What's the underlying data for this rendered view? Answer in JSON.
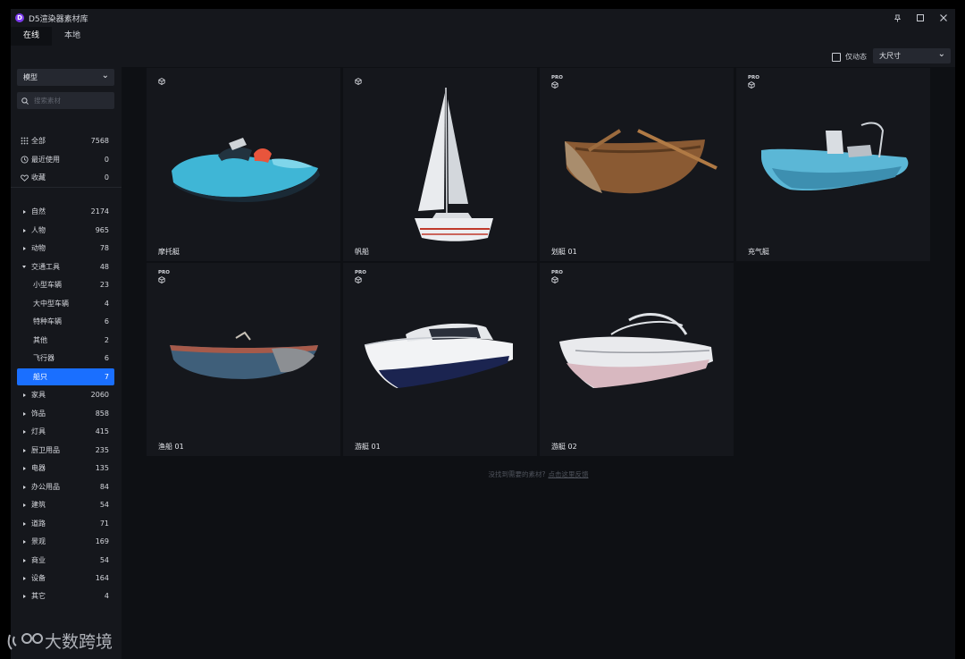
{
  "app": {
    "title": "D5渲染器素材库",
    "logo_letter": "D"
  },
  "window_controls": [
    "pin-icon",
    "maximize-icon",
    "close-icon"
  ],
  "tabs": [
    {
      "label": "在线",
      "active": true
    },
    {
      "label": "本地",
      "active": false
    }
  ],
  "toolbar": {
    "animated_only_label": "仅动态",
    "animated_only_checked": false,
    "size_value": "大尺寸"
  },
  "sidebar": {
    "type_value": "模型",
    "search_placeholder": "搜索素材",
    "quick": [
      {
        "label": "全部",
        "count": "7568",
        "icon": "grid-icon"
      },
      {
        "label": "最近使用",
        "count": "0",
        "icon": "clock-icon"
      },
      {
        "label": "收藏",
        "count": "0",
        "icon": "heart-icon"
      }
    ],
    "categories": [
      {
        "label": "自然",
        "count": "2174",
        "expanded": false
      },
      {
        "label": "人物",
        "count": "965",
        "expanded": false
      },
      {
        "label": "动物",
        "count": "78",
        "expanded": false
      },
      {
        "label": "交通工具",
        "count": "48",
        "expanded": true
      },
      {
        "label": "小型车辆",
        "count": "23",
        "child": true
      },
      {
        "label": "大中型车辆",
        "count": "4",
        "child": true
      },
      {
        "label": "特种车辆",
        "count": "6",
        "child": true
      },
      {
        "label": "其他",
        "count": "2",
        "child": true
      },
      {
        "label": "飞行器",
        "count": "6",
        "child": true
      },
      {
        "label": "船只",
        "count": "7",
        "child": true,
        "selected": true
      },
      {
        "label": "家具",
        "count": "2060",
        "expanded": false
      },
      {
        "label": "饰品",
        "count": "858",
        "expanded": false
      },
      {
        "label": "灯具",
        "count": "415",
        "expanded": false
      },
      {
        "label": "厨卫用品",
        "count": "235",
        "expanded": false
      },
      {
        "label": "电器",
        "count": "135",
        "expanded": false
      },
      {
        "label": "办公用品",
        "count": "84",
        "expanded": false
      },
      {
        "label": "建筑",
        "count": "54",
        "expanded": false
      },
      {
        "label": "道路",
        "count": "71",
        "expanded": false
      },
      {
        "label": "景观",
        "count": "169",
        "expanded": false
      },
      {
        "label": "商业",
        "count": "54",
        "expanded": false
      },
      {
        "label": "设备",
        "count": "164",
        "expanded": false
      },
      {
        "label": "其它",
        "count": "4",
        "expanded": false
      }
    ]
  },
  "items": [
    {
      "name": "摩托艇",
      "pro": false,
      "thumb": "jetski"
    },
    {
      "name": "帆船",
      "pro": false,
      "thumb": "sailboat"
    },
    {
      "name": "划艇 01",
      "pro": true,
      "thumb": "rowboat"
    },
    {
      "name": "充气艇",
      "pro": true,
      "thumb": "inflatable"
    },
    {
      "name": "渔船 01",
      "pro": true,
      "thumb": "fishing"
    },
    {
      "name": "游艇 01",
      "pro": true,
      "thumb": "yacht1"
    },
    {
      "name": "游艇 02",
      "pro": true,
      "thumb": "yacht2"
    }
  ],
  "pro_badge": "PRO",
  "feedback": {
    "text": "没找到需要的素材?",
    "link": "点击这里反馈"
  },
  "watermark": "大数跨境",
  "colors": {
    "accent": "#1a6fff",
    "panel": "#15171c",
    "background": "#0e1014",
    "logo": "#7c3aed"
  }
}
